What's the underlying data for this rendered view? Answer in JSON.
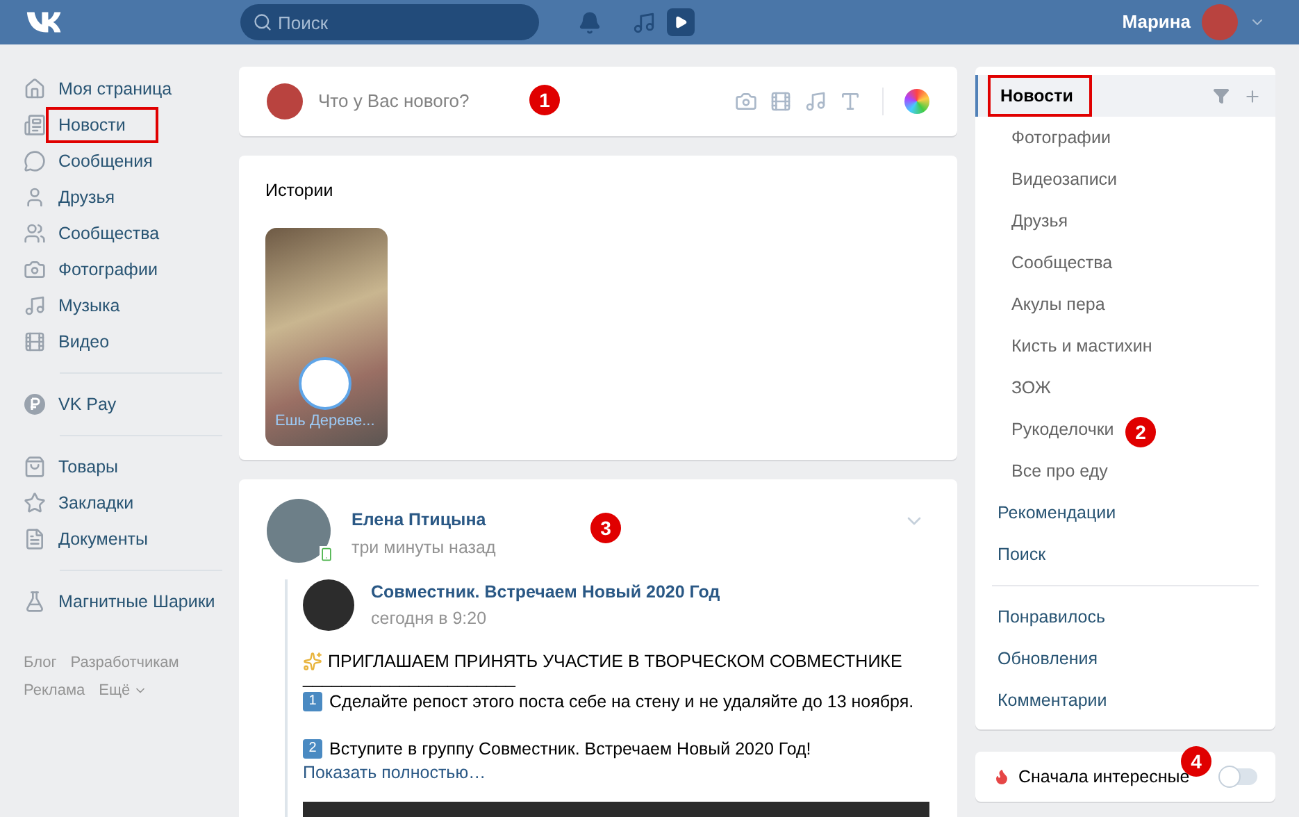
{
  "header": {
    "search": {
      "placeholder": "Поиск"
    },
    "user_name": "Марина"
  },
  "left_nav": {
    "groups": [
      [
        {
          "label": "Моя страница",
          "highlighted": false
        },
        {
          "label": "Новости",
          "highlighted": true
        },
        {
          "label": "Сообщения",
          "highlighted": false
        },
        {
          "label": "Друзья",
          "highlighted": false
        },
        {
          "label": "Сообщества",
          "highlighted": false
        },
        {
          "label": "Фотографии",
          "highlighted": false
        },
        {
          "label": "Музыка",
          "highlighted": false
        },
        {
          "label": "Видео",
          "highlighted": false
        }
      ],
      [
        {
          "label": "VK Pay",
          "highlighted": false
        }
      ],
      [
        {
          "label": "Товары",
          "highlighted": false
        },
        {
          "label": "Закладки",
          "highlighted": false
        },
        {
          "label": "Документы",
          "highlighted": false
        }
      ],
      [
        {
          "label": "Магнитные Шарики",
          "highlighted": false
        }
      ]
    ],
    "footer_links": [
      "Блог",
      "Разработчикам",
      "Реклама",
      "Ещё"
    ]
  },
  "composer": {
    "placeholder": "Что у Вас нового?"
  },
  "stories": {
    "title": "Истории",
    "items": [
      {
        "caption": "Ешь Дереве..."
      }
    ]
  },
  "post": {
    "author": "Елена Птицына",
    "time": "три минуты назад",
    "repost": {
      "group": "Совместник. Встречаем Новый 2020 Год",
      "time": "сегодня в 9:20",
      "lines": [
        {
          "kind": "title",
          "text": "ПРИГЛАШАЕМ ПРИНЯТЬ УЧАСТИЕ В ТВОРЧЕСКОМ СОВМЕСТНИКЕ"
        },
        {
          "kind": "rule",
          "text": "______________________"
        },
        {
          "kind": "step",
          "number": "1",
          "text": "Сделайте репост этого поста себе на стену и не удаляйте до 13 ноября."
        },
        {
          "kind": "step",
          "number": "2",
          "text": "Вступите в группу Совместник. Встречаем Новый 2020 Год!"
        }
      ],
      "more": "Показать полностью…"
    }
  },
  "right_menu": {
    "groups": [
      [
        {
          "label": "Новости",
          "selected": true,
          "highlighted": true,
          "children": [
            {
              "label": "Фотографии"
            },
            {
              "label": "Видеозаписи"
            },
            {
              "label": "Друзья"
            },
            {
              "label": "Сообщества"
            },
            {
              "label": "Акулы пера"
            },
            {
              "label": "Кисть и мастихин"
            },
            {
              "label": "ЗОЖ"
            },
            {
              "label": "Рукоделочки"
            },
            {
              "label": "Все про еду"
            }
          ]
        },
        {
          "label": "Рекомендации",
          "selected": false,
          "highlighted": false
        },
        {
          "label": "Поиск",
          "selected": false,
          "highlighted": false
        }
      ],
      [
        {
          "label": "Понравилось",
          "selected": false,
          "highlighted": false
        },
        {
          "label": "Обновления",
          "selected": false,
          "highlighted": false
        },
        {
          "label": "Комментарии",
          "selected": false,
          "highlighted": false
        }
      ]
    ]
  },
  "interesting_first": {
    "label": "Сначала интересные",
    "on": false
  },
  "callouts": [
    "1",
    "2",
    "3",
    "4"
  ]
}
